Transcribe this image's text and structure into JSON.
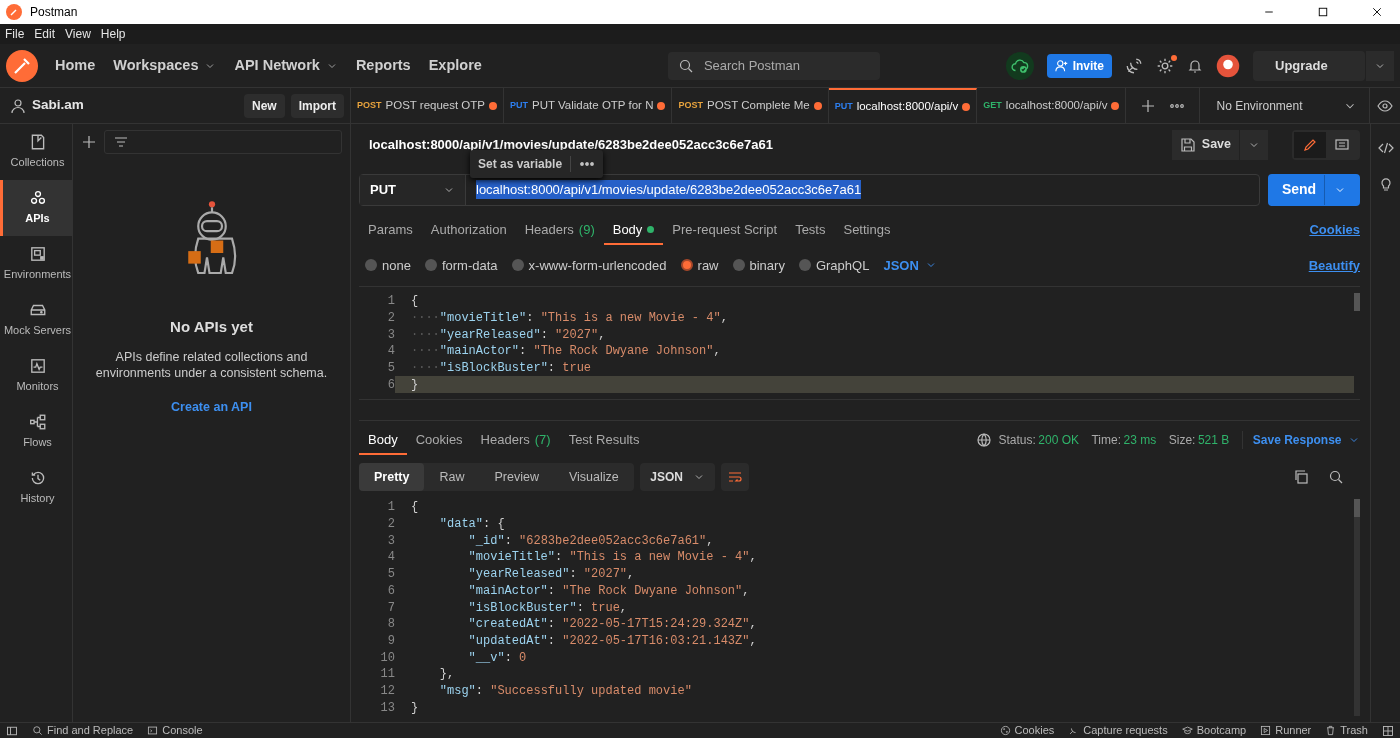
{
  "window": {
    "title": "Postman"
  },
  "menu": [
    "File",
    "Edit",
    "View",
    "Help"
  ],
  "nav": [
    {
      "label": "Home",
      "dropdown": false
    },
    {
      "label": "Workspaces",
      "dropdown": true
    },
    {
      "label": "API Network",
      "dropdown": true
    },
    {
      "label": "Reports",
      "dropdown": false
    },
    {
      "label": "Explore",
      "dropdown": false
    }
  ],
  "search": {
    "placeholder": "Search Postman"
  },
  "header_actions": {
    "invite": "Invite",
    "upgrade": "Upgrade",
    "settings_badge": true
  },
  "workspace": {
    "name": "Sabi.am",
    "buttons": [
      "New",
      "Import"
    ]
  },
  "sidebar": {
    "items": [
      {
        "label": "Collections",
        "selected": false
      },
      {
        "label": "APIs",
        "selected": true
      },
      {
        "label": "Environments",
        "selected": false
      },
      {
        "label": "Mock Servers",
        "selected": false
      },
      {
        "label": "Monitors",
        "selected": false
      },
      {
        "label": "Flows",
        "selected": false
      },
      {
        "label": "History",
        "selected": false
      }
    ]
  },
  "empty_state": {
    "title": "No APIs yet",
    "text": "APIs define related collections and environments under a consistent schema.",
    "link": "Create an API"
  },
  "tabs": [
    {
      "method": "POST",
      "color": "#e8a33d",
      "label": "POST request OTP",
      "unsaved": true,
      "selected": false
    },
    {
      "method": "PUT",
      "color": "#2d7ff0",
      "label": "PUT Validate OTP for N",
      "unsaved": true,
      "selected": false
    },
    {
      "method": "POST",
      "color": "#e8a33d",
      "label": "POST Complete Me",
      "unsaved": true,
      "selected": false
    },
    {
      "method": "PUT",
      "color": "#2d7ff0",
      "label": "localhost:8000/api/v",
      "unsaved": true,
      "selected": true
    },
    {
      "method": "GET",
      "color": "#2fb36a",
      "label": "localhost:8000/api/v",
      "unsaved": true,
      "selected": false
    }
  ],
  "environment": "No Environment",
  "request": {
    "title": "localhost:8000/api/v1/movies/update/6283be2dee052acc3c6e7a61",
    "save": "Save",
    "tooltip": "Set as variable",
    "method": "PUT",
    "url": "localhost:8000/api/v1/movies/update/6283be2dee052acc3c6e7a61",
    "url_selected": true,
    "send": "Send",
    "tabs": [
      {
        "label": "Params",
        "selected": false
      },
      {
        "label": "Authorization",
        "selected": false
      },
      {
        "label": "Headers",
        "count": "(9)",
        "selected": false
      },
      {
        "label": "Body",
        "dot": true,
        "selected": true
      },
      {
        "label": "Pre-request Script",
        "selected": false
      },
      {
        "label": "Tests",
        "selected": false
      },
      {
        "label": "Settings",
        "selected": false
      }
    ],
    "cookies": "Cookies",
    "body_types": [
      {
        "label": "none",
        "selected": false
      },
      {
        "label": "form-data",
        "selected": false
      },
      {
        "label": "x-www-form-urlencoded",
        "selected": false
      },
      {
        "label": "raw",
        "selected": true
      },
      {
        "label": "binary",
        "selected": false
      },
      {
        "label": "GraphQL",
        "selected": false
      }
    ],
    "format": "JSON",
    "beautify": "Beautify",
    "body_lines": [
      {
        "no": "1",
        "current": false,
        "tokens": [
          {
            "kind": "punct",
            "text": "{"
          }
        ]
      },
      {
        "no": "2",
        "current": false,
        "tokens": [
          {
            "kind": "whitespace",
            "text": "····"
          },
          {
            "kind": "key",
            "text": "\"movieTitle\""
          },
          {
            "kind": "punct",
            "text": ": "
          },
          {
            "kind": "string",
            "text": "\"This is a new Movie - 4\""
          },
          {
            "kind": "punct",
            "text": ","
          }
        ]
      },
      {
        "no": "3",
        "current": false,
        "tokens": [
          {
            "kind": "whitespace",
            "text": "····"
          },
          {
            "kind": "key",
            "text": "\"yearReleased\""
          },
          {
            "kind": "punct",
            "text": ": "
          },
          {
            "kind": "string",
            "text": "\"2027\""
          },
          {
            "kind": "punct",
            "text": ","
          }
        ]
      },
      {
        "no": "4",
        "current": false,
        "tokens": [
          {
            "kind": "whitespace",
            "text": "····"
          },
          {
            "kind": "key",
            "text": "\"mainActor\""
          },
          {
            "kind": "punct",
            "text": ": "
          },
          {
            "kind": "string",
            "text": "\"The Rock Dwyane Johnson\""
          },
          {
            "kind": "punct",
            "text": ","
          }
        ]
      },
      {
        "no": "5",
        "current": false,
        "tokens": [
          {
            "kind": "whitespace",
            "text": "····"
          },
          {
            "kind": "key",
            "text": "\"isBlockBuster\""
          },
          {
            "kind": "punct",
            "text": ": "
          },
          {
            "kind": "literal",
            "text": "true"
          }
        ]
      },
      {
        "no": "6",
        "current": true,
        "tokens": [
          {
            "kind": "punct",
            "text": "}"
          }
        ]
      }
    ]
  },
  "response": {
    "tabs": [
      {
        "label": "Body",
        "selected": true
      },
      {
        "label": "Cookies",
        "selected": false
      },
      {
        "label": "Headers",
        "count": "(7)",
        "selected": false
      },
      {
        "label": "Test Results",
        "selected": false
      }
    ],
    "status_label": "Status:",
    "status": "200 OK",
    "time_label": "Time:",
    "time": "23 ms",
    "size_label": "Size:",
    "size": "521 B",
    "save": "Save Response",
    "views": [
      {
        "label": "Pretty",
        "selected": true
      },
      {
        "label": "Raw",
        "selected": false
      },
      {
        "label": "Preview",
        "selected": false
      },
      {
        "label": "Visualize",
        "selected": false
      }
    ],
    "format": "JSON",
    "wrap_on": true,
    "lines": [
      {
        "no": "1",
        "tokens": [
          {
            "kind": "punct",
            "text": "{"
          }
        ]
      },
      {
        "no": "2",
        "tokens": [
          {
            "kind": "key",
            "text": "    \"data\""
          },
          {
            "kind": "punct",
            "text": ": {"
          }
        ]
      },
      {
        "no": "3",
        "tokens": [
          {
            "kind": "key",
            "text": "        \"_id\""
          },
          {
            "kind": "punct",
            "text": ": "
          },
          {
            "kind": "string",
            "text": "\"6283be2dee052acc3c6e7a61\""
          },
          {
            "kind": "punct",
            "text": ","
          }
        ]
      },
      {
        "no": "4",
        "tokens": [
          {
            "kind": "key",
            "text": "        \"movieTitle\""
          },
          {
            "kind": "punct",
            "text": ": "
          },
          {
            "kind": "string",
            "text": "\"This is a new Movie - 4\""
          },
          {
            "kind": "punct",
            "text": ","
          }
        ]
      },
      {
        "no": "5",
        "tokens": [
          {
            "kind": "key",
            "text": "        \"yearReleased\""
          },
          {
            "kind": "punct",
            "text": ": "
          },
          {
            "kind": "string",
            "text": "\"2027\""
          },
          {
            "kind": "punct",
            "text": ","
          }
        ]
      },
      {
        "no": "6",
        "tokens": [
          {
            "kind": "key",
            "text": "        \"mainActor\""
          },
          {
            "kind": "punct",
            "text": ": "
          },
          {
            "kind": "string",
            "text": "\"The Rock Dwyane Johnson\""
          },
          {
            "kind": "punct",
            "text": ","
          }
        ]
      },
      {
        "no": "7",
        "tokens": [
          {
            "kind": "key",
            "text": "        \"isBlockBuster\""
          },
          {
            "kind": "punct",
            "text": ": "
          },
          {
            "kind": "literal",
            "text": "true"
          },
          {
            "kind": "punct",
            "text": ","
          }
        ]
      },
      {
        "no": "8",
        "tokens": [
          {
            "kind": "key",
            "text": "        \"createdAt\""
          },
          {
            "kind": "punct",
            "text": ": "
          },
          {
            "kind": "string",
            "text": "\"2022-05-17T15:24:29.324Z\""
          },
          {
            "kind": "punct",
            "text": ","
          }
        ]
      },
      {
        "no": "9",
        "tokens": [
          {
            "kind": "key",
            "text": "        \"updatedAt\""
          },
          {
            "kind": "punct",
            "text": ": "
          },
          {
            "kind": "string",
            "text": "\"2022-05-17T16:03:21.143Z\""
          },
          {
            "kind": "punct",
            "text": ","
          }
        ]
      },
      {
        "no": "10",
        "tokens": [
          {
            "kind": "key",
            "text": "        \"__v\""
          },
          {
            "kind": "punct",
            "text": ": "
          },
          {
            "kind": "literal",
            "text": "0"
          }
        ]
      },
      {
        "no": "11",
        "tokens": [
          {
            "kind": "punct",
            "text": "    },"
          }
        ]
      },
      {
        "no": "12",
        "tokens": [
          {
            "kind": "key",
            "text": "    \"msg\""
          },
          {
            "kind": "punct",
            "text": ": "
          },
          {
            "kind": "string",
            "text": "\"Successfully updated movie\""
          }
        ]
      },
      {
        "no": "13",
        "tokens": [
          {
            "kind": "punct",
            "text": "}"
          }
        ]
      }
    ]
  },
  "status_bar": {
    "left": [
      "Find and Replace",
      "Console"
    ],
    "right": [
      "Cookies",
      "Capture requests",
      "Bootcamp",
      "Runner",
      "Trash"
    ]
  }
}
